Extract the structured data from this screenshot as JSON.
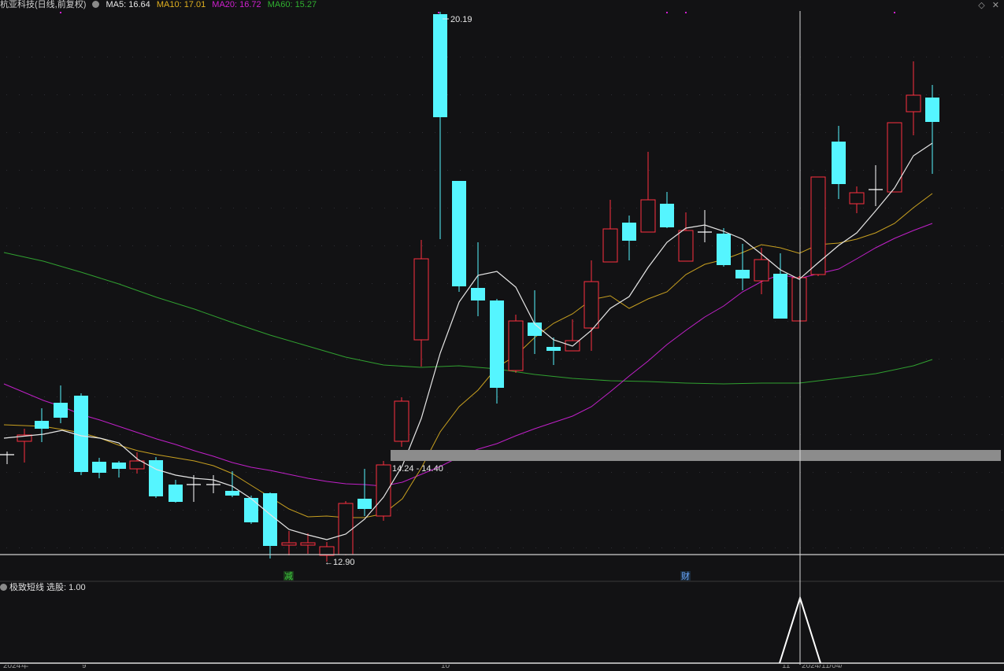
{
  "header": {
    "title": "杭亚科技(日线,前复权)",
    "ma5": "MA5: 16.64",
    "ma10": "MA10: 17.01",
    "ma20": "MA20: 16.72",
    "ma60": "MA60: 15.27",
    "colors": {
      "ma5": "#ffffff",
      "ma10": "#e0b020",
      "ma20": "#d020d0",
      "ma60": "#30b030"
    }
  },
  "window_controls": {
    "diamond": "◇",
    "close": "✕"
  },
  "main_chart": {
    "high_label": "20.19",
    "low_label": "←12.90",
    "zone_label": "14.24 - 14.40",
    "marker_reduce": "减",
    "marker_finance": "财",
    "up_color": "#ff3040",
    "down_color": "#55f5ff"
  },
  "sub_chart": {
    "title": "极致短线  选股: 1.00"
  },
  "bottom_axis": {
    "labels": [
      "2024年",
      "9",
      "10",
      "11",
      "2024/11/04/"
    ]
  }
}
